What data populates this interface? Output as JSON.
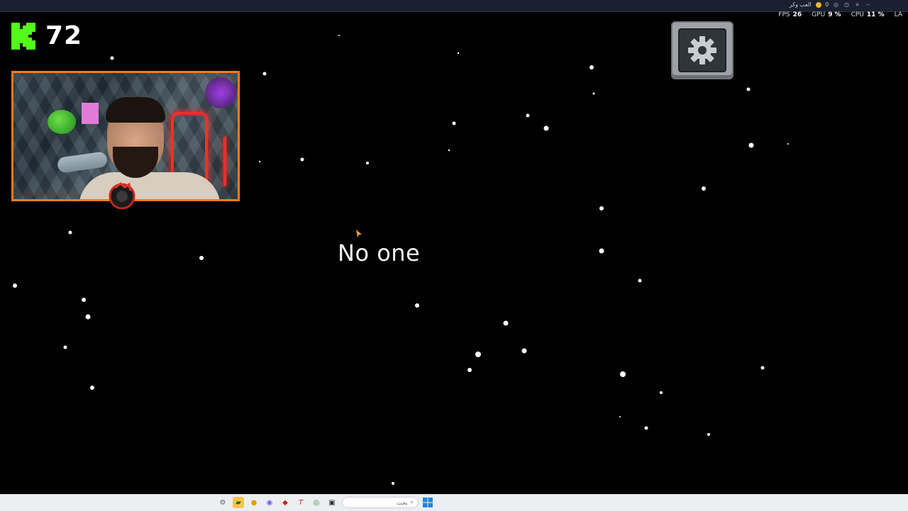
{
  "overlay": {
    "fps_label": "FPS",
    "fps_value": "26",
    "gpu_label": "GPU",
    "gpu_value": "9 %",
    "cpu_label": "CPU",
    "cpu_value": "11 %",
    "lag_label": "LA",
    "coins_value": "0",
    "mini_label": "العب وكر"
  },
  "kick": {
    "viewers": "72",
    "brand_color": "#53fc18"
  },
  "game": {
    "center_text": "No one"
  },
  "taskbar": {
    "search_placeholder": "بحث",
    "icons": [
      "settings-icon",
      "files-icon",
      "coin-icon",
      "discord-icon",
      "game-icon",
      "text-icon",
      "chrome-icon",
      "window-icon"
    ]
  },
  "colors": {
    "webcam_border": "#ff7a1a",
    "background": "#000000"
  }
}
